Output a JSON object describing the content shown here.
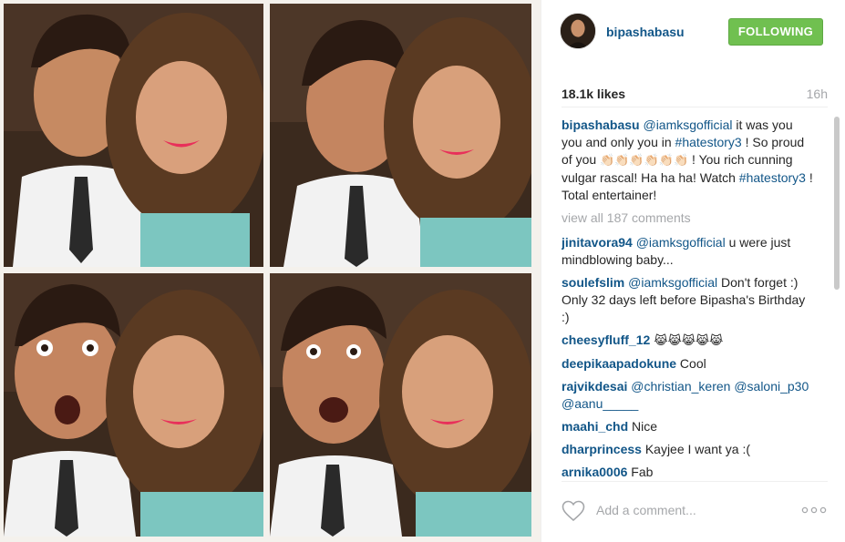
{
  "post": {
    "username": "bipashabasu",
    "follow_label": "FOLLOWING",
    "likes": "18.1k likes",
    "time": "16h",
    "caption": {
      "user": "bipashabasu",
      "mention": "@iamksgofficial",
      "text1": " it was you you and only you in ",
      "hashtag1": "#hatestory3",
      "text2": " ! So proud of you ",
      "emoji": "👏🏻👏🏻👏🏻👏🏻👏🏻👏🏻",
      "text3": " ! You rich cunning vulgar rascal! Ha ha ha! Watch ",
      "hashtag2": "#hatestory3",
      "text4": " ! Total entertainer!"
    },
    "view_all": "view all 187 comments",
    "comments": [
      {
        "user": "jinitavora94",
        "mention": "@iamksgofficial",
        "text": " u were just mindblowing baby..."
      },
      {
        "user": "soulefslim",
        "mention": "@iamksgofficial",
        "text": " Don't forget :) Only 32 days left before Bipasha's Birthday :)"
      },
      {
        "user": "cheesyfluff_12",
        "mention": "",
        "text": " 😹😹😹😹😹"
      },
      {
        "user": "deepikaapadokune",
        "mention": "",
        "text": " Cool"
      },
      {
        "user": "rajvikdesai",
        "mention": "@christian_keren @saloni_p30 @aanu_____",
        "text": ""
      },
      {
        "user": "maahi_chd",
        "mention": "",
        "text": " Nice"
      },
      {
        "user": "dharprincess",
        "mention": "",
        "text": " Kayjee I want ya :("
      },
      {
        "user": "arnika0006",
        "mention": "",
        "text": " Fab"
      }
    ],
    "add_comment_placeholder": "Add a comment...",
    "icons": {
      "like": "heart-icon",
      "more": "more-options-icon"
    },
    "colors": {
      "follow": "#70c050",
      "link": "#125688",
      "muted": "#a5a7aa"
    }
  }
}
